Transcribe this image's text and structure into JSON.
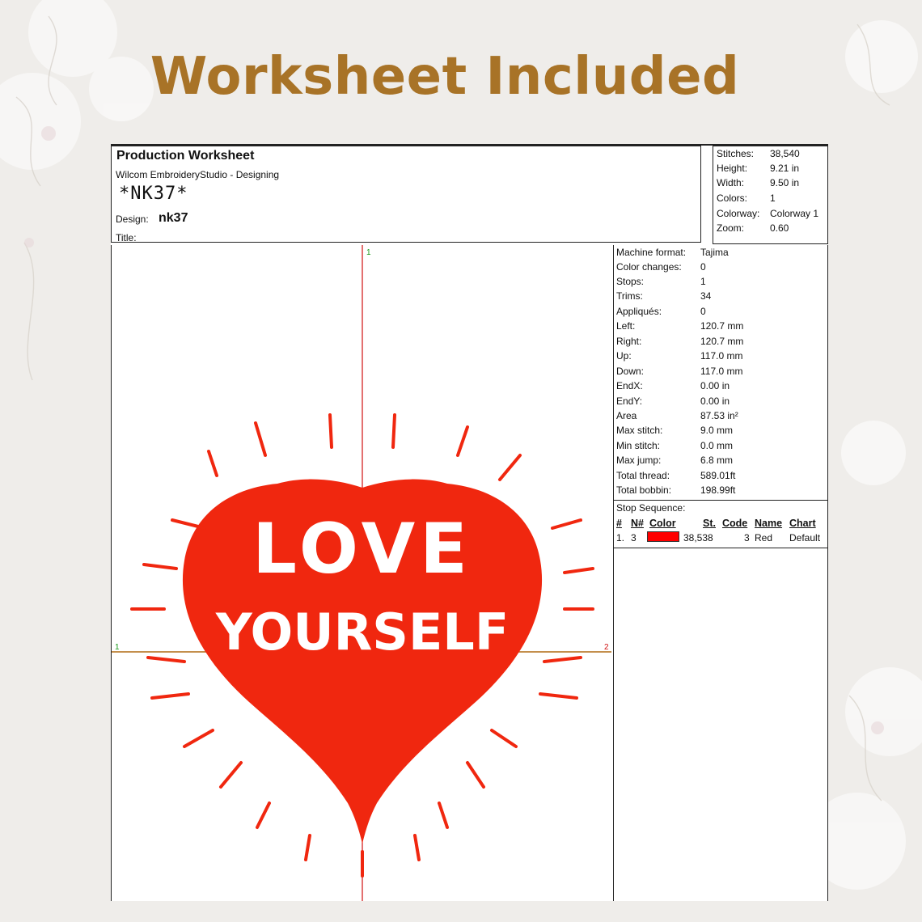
{
  "banner_title": "Worksheet Included",
  "worksheet": {
    "heading": "Production Worksheet",
    "software": "Wilcom EmbroideryStudio - Designing",
    "design_code": "*NK37*",
    "design_label": "Design:",
    "design_name": "nk37",
    "title_label": "Title:"
  },
  "summary": [
    {
      "label": "Stitches:",
      "value": "38,540"
    },
    {
      "label": "Height:",
      "value": "9.21 in"
    },
    {
      "label": "Width:",
      "value": "9.50 in"
    },
    {
      "label": "Colors:",
      "value": "1"
    },
    {
      "label": "Colorway:",
      "value": "Colorway 1"
    },
    {
      "label": "Zoom:",
      "value": "0.60"
    }
  ],
  "parameters": [
    {
      "label": "Machine format:",
      "value": "Tajima"
    },
    {
      "label": "Color changes:",
      "value": "0"
    },
    {
      "label": "Stops:",
      "value": "1"
    },
    {
      "label": "Trims:",
      "value": "34"
    },
    {
      "label": "Appliqués:",
      "value": "0"
    },
    {
      "label": "Left:",
      "value": "120.7 mm"
    },
    {
      "label": "Right:",
      "value": "120.7 mm"
    },
    {
      "label": "Up:",
      "value": "117.0 mm"
    },
    {
      "label": "Down:",
      "value": "117.0 mm"
    },
    {
      "label": "EndX:",
      "value": "0.00 in"
    },
    {
      "label": "EndY:",
      "value": "0.00 in"
    },
    {
      "label": "Area",
      "value": " 87.53 in²"
    },
    {
      "label": "Max stitch:",
      "value": "9.0 mm"
    },
    {
      "label": "Min stitch:",
      "value": "0.0 mm"
    },
    {
      "label": "Max jump:",
      "value": "6.8 mm"
    },
    {
      "label": "Total thread:",
      "value": "589.01ft"
    },
    {
      "label": "Total bobbin:",
      "value": "198.99ft"
    }
  ],
  "stop_sequence": {
    "title": "Stop Sequence:",
    "headers": {
      "num": "#",
      "needle": "N#",
      "color": "Color",
      "stitches": "St.",
      "code": "Code",
      "name": "Name",
      "chart": "Chart"
    },
    "rows": [
      {
        "num": "1.",
        "needle": "3",
        "swatch": "#ff0000",
        "stitches": "38,538",
        "code": "3",
        "name": "Red",
        "chart": "Default"
      }
    ]
  },
  "design": {
    "line1": "LOVE",
    "line2": "YOURSELF",
    "color": "#f0270f",
    "axis_labels": {
      "top": "1",
      "left": "1",
      "right": "2"
    }
  }
}
